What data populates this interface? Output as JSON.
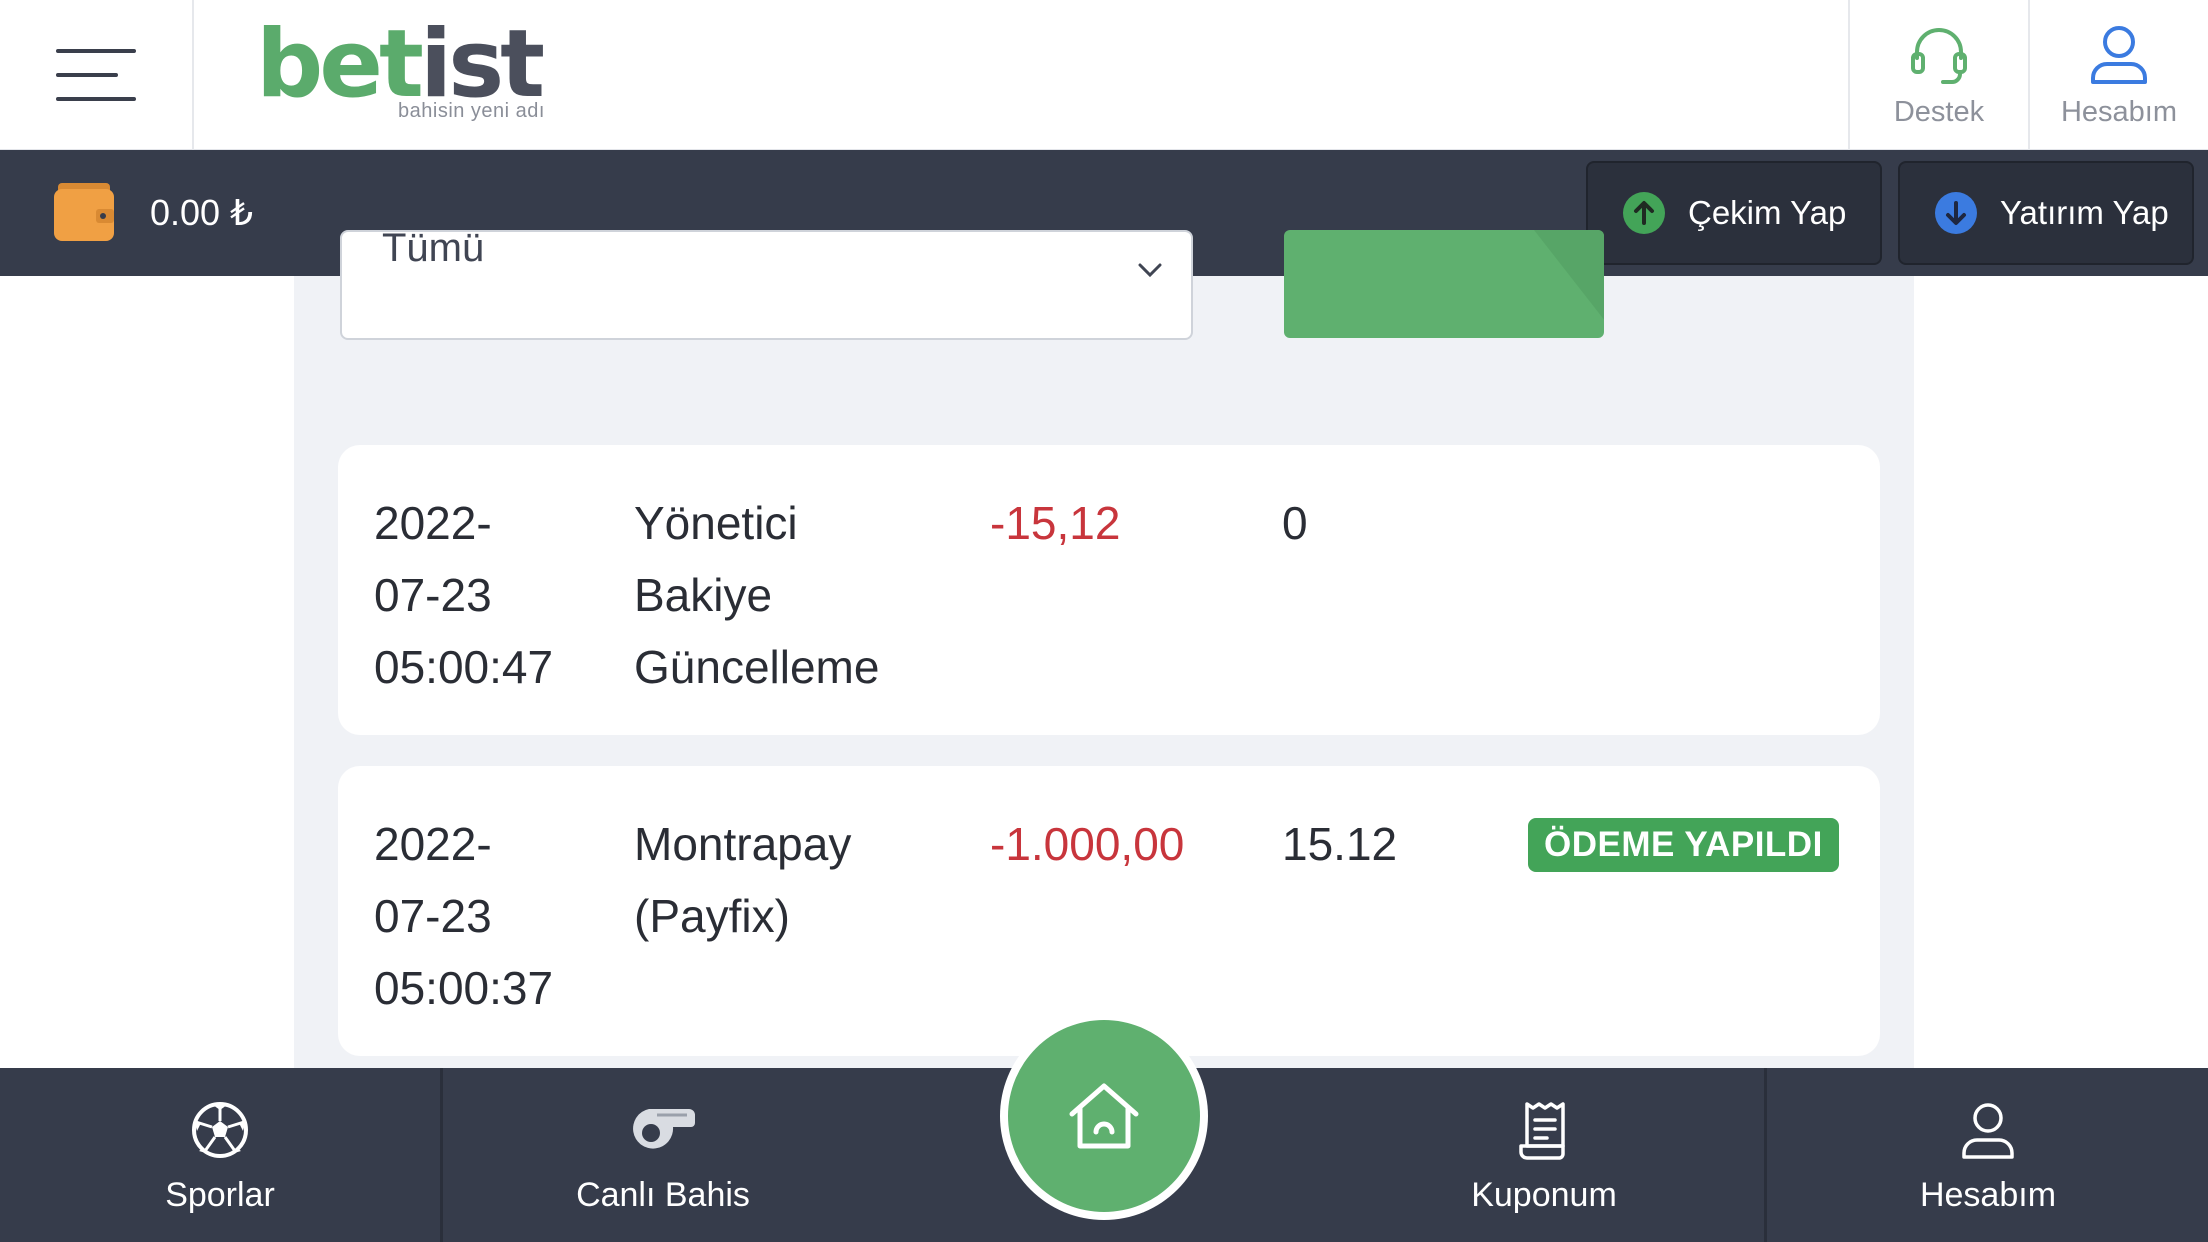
{
  "header": {
    "logo": {
      "word_main": "bet",
      "word_accent": "ist",
      "tagline": "bahisin yeni adı"
    },
    "support_label": "Destek",
    "account_label": "Hesabım"
  },
  "balance_bar": {
    "balance": "0.00 ₺",
    "withdraw_label": "Çekim Yap",
    "deposit_label": "Yatırım Yap"
  },
  "filter": {
    "select_value": "Tümü"
  },
  "transactions": [
    {
      "date_line1": "2022-",
      "date_line2": "07-23",
      "time": "05:00:47",
      "desc_line1": "Yönetici",
      "desc_line2": "Bakiye",
      "desc_line3": "Güncelleme",
      "amount": "-15,12",
      "balance": "0",
      "status": ""
    },
    {
      "date_line1": "2022-",
      "date_line2": "07-23",
      "time": "05:00:37",
      "desc_line1": "Montrapay",
      "desc_line2": "(Payfix)",
      "desc_line3": "",
      "amount": "-1.000,00",
      "balance": "15.12",
      "status": "ÖDEME YAPILDI"
    }
  ],
  "bottom_nav": {
    "sports": "Sporlar",
    "live": "Canlı Bahis",
    "coupon": "Kuponum",
    "account": "Hesabım"
  },
  "colors": {
    "brand_green": "#5fb06f",
    "dark_bar": "#363c4b",
    "negative_amount": "#c8353c",
    "status_paid": "#43a458"
  }
}
